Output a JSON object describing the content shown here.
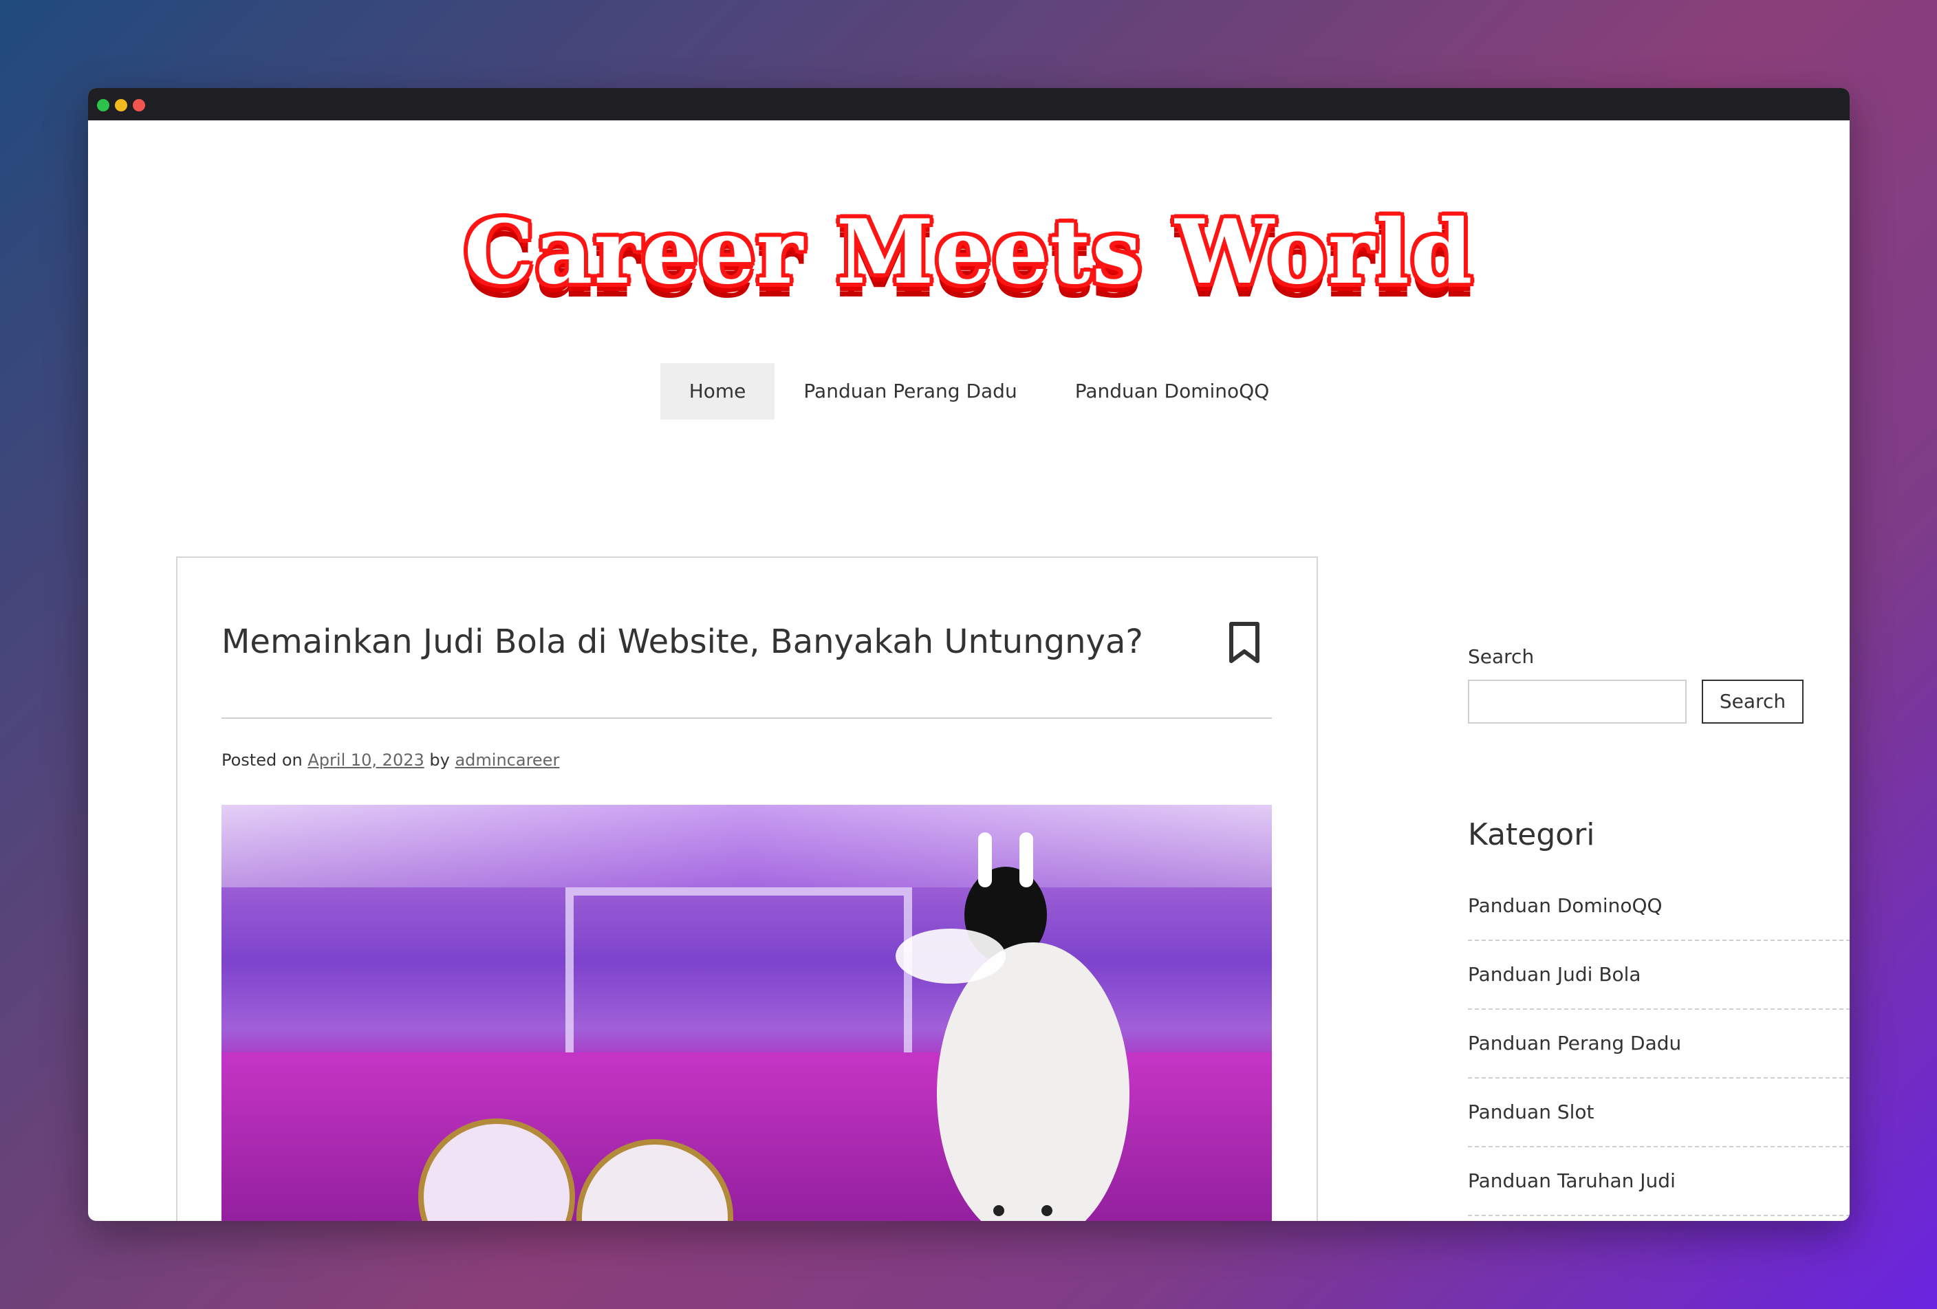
{
  "site": {
    "logo_text": "Career Meets World"
  },
  "nav": {
    "items": [
      "Home",
      "Panduan Perang Dadu",
      "Panduan DominoQQ"
    ]
  },
  "post": {
    "title": "Memainkan Judi Bola di Website, Banyakah Untungnya?",
    "posted_on": "Posted on",
    "date": "April 10, 2023",
    "by": "by",
    "author": "admincareer"
  },
  "sidebar": {
    "search_label": "Search",
    "search_button": "Search",
    "search_value": "",
    "kategori_title": "Kategori",
    "categories": [
      "Panduan DominoQQ",
      "Panduan Judi Bola",
      "Panduan Perang Dadu",
      "Panduan Slot",
      "Panduan Taruhan Judi"
    ]
  }
}
